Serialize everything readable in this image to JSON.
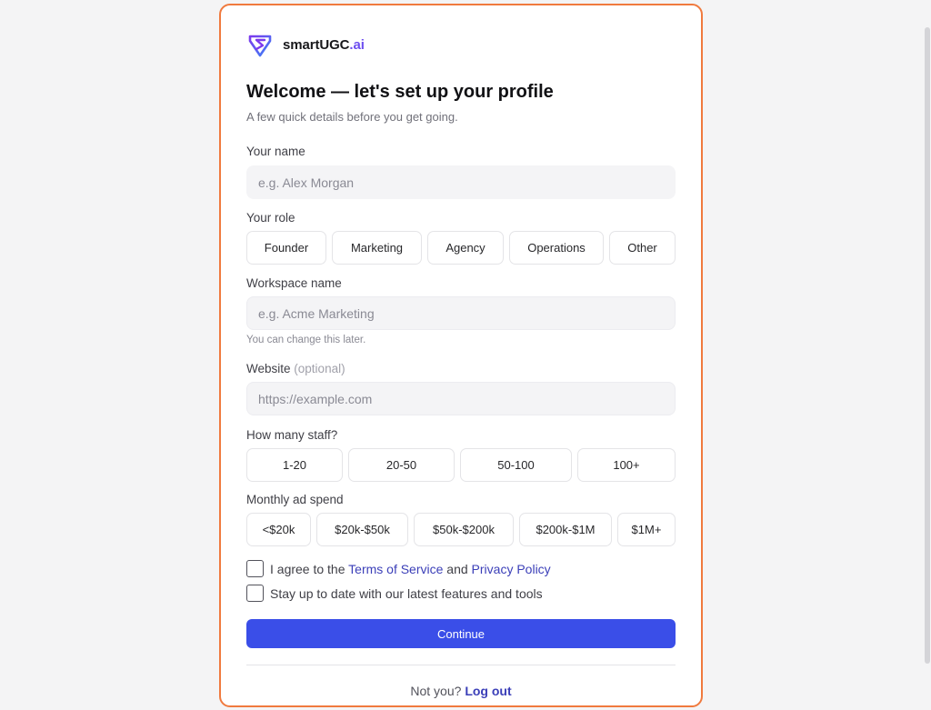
{
  "brand": {
    "name": "smartUGC",
    "suffix": ".ai",
    "icon": "superhero-s-logo-icon"
  },
  "heading": {
    "title": "Welcome — let's set up your profile",
    "subtitle": "A few quick details before you get going."
  },
  "name_field": {
    "label": "Your name",
    "placeholder": "e.g. Alex Morgan",
    "value": ""
  },
  "role_field": {
    "label": "Your role",
    "options": [
      "Founder",
      "Marketing",
      "Agency",
      "Operations",
      "Other"
    ],
    "selected": null
  },
  "workspace_field": {
    "label": "Workspace name",
    "placeholder": "e.g. Acme Marketing",
    "value": "",
    "hint": "You can change this later."
  },
  "website_field": {
    "label": "Website",
    "optional_tag": "(optional)",
    "placeholder": "https://example.com",
    "value": ""
  },
  "staff_field": {
    "label": "How many staff?",
    "options": [
      "1-20",
      "20-50",
      "50-100",
      "100+"
    ],
    "selected": null
  },
  "ad_spend_field": {
    "label": "Monthly ad spend",
    "options": [
      "<$20k",
      "$20k-$50k",
      "$50k-$200k",
      "$200k-$1M",
      "$1M+"
    ],
    "selected": null
  },
  "consents": {
    "terms": {
      "checked": false,
      "prefix": "I agree to the",
      "terms_link": "Terms of Service",
      "joiner": "and",
      "privacy_link": "Privacy Policy"
    },
    "updates": {
      "checked": false,
      "label": "Stay up to date with our latest features and tools"
    }
  },
  "continue_label": "Continue",
  "footer": {
    "prompt": "Not you?",
    "logout_label": "Log out"
  },
  "colors": {
    "card_border": "#f07a3e",
    "primary": "#3a4ee8",
    "link": "#3b3fb8",
    "brand_accent": "#6d4ef0"
  }
}
